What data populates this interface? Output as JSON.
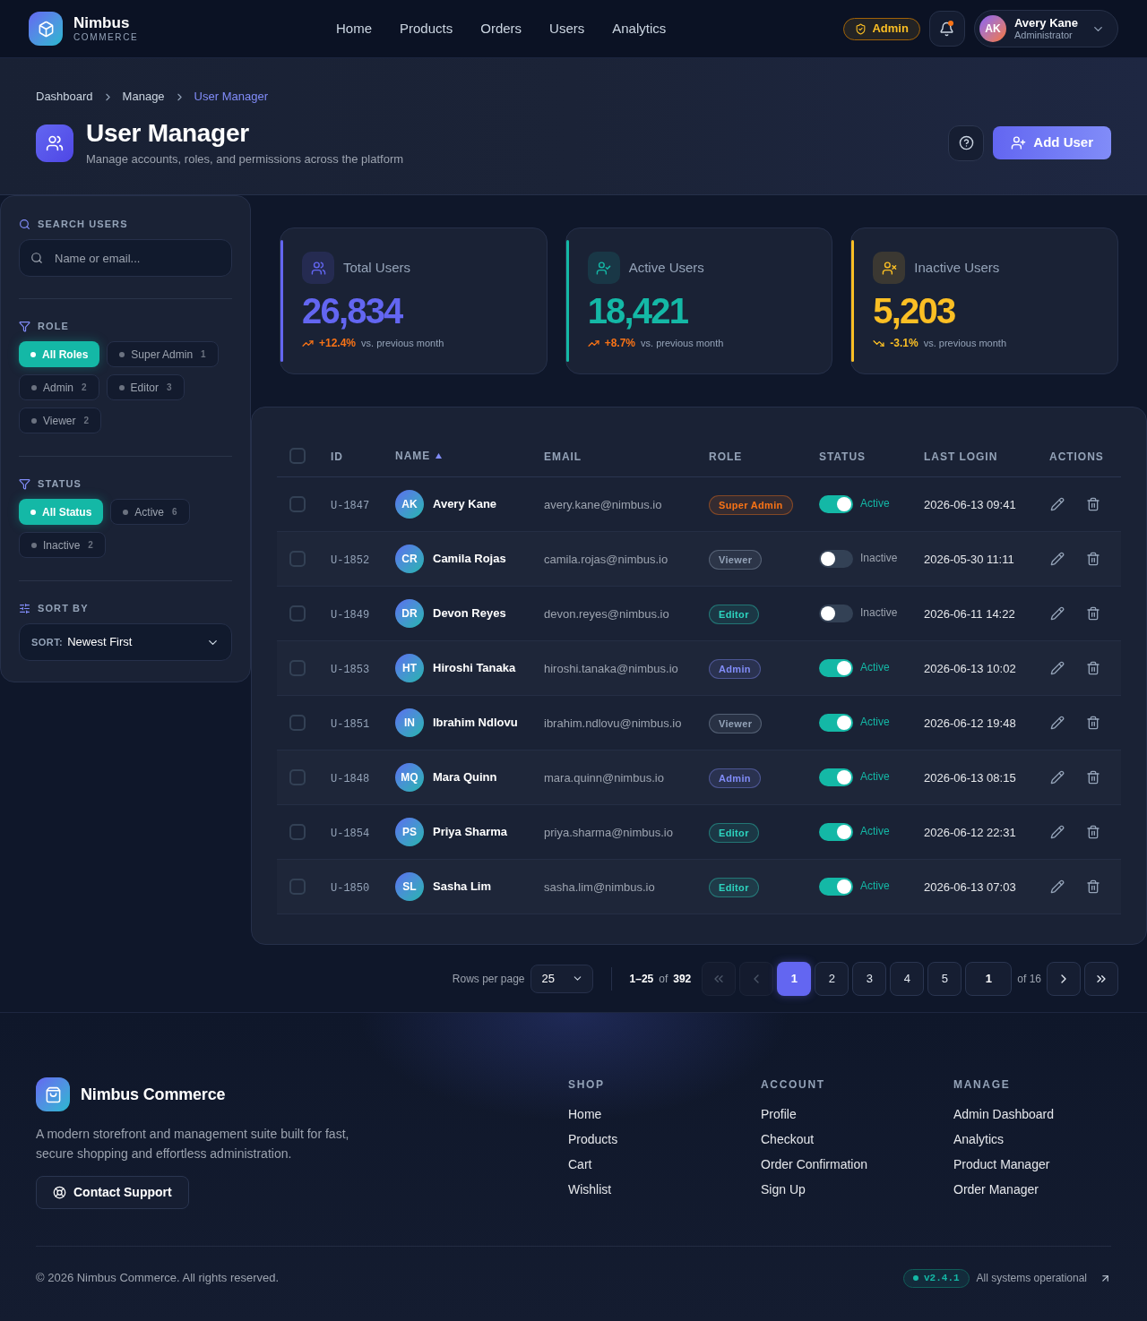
{
  "header": {
    "brand": {
      "name": "Nimbus",
      "tagline": "COMMERCE"
    },
    "nav": [
      {
        "label": "Home",
        "selected": false
      },
      {
        "label": "Products",
        "selected": false
      },
      {
        "label": "Orders",
        "selected": false
      },
      {
        "label": "Users",
        "selected": false
      },
      {
        "label": "Analytics",
        "selected": false
      }
    ],
    "role_badge": "Admin",
    "notifications": {
      "unread": true
    },
    "user": {
      "initials": "AK",
      "name": "Avery Kane",
      "role": "Administrator"
    }
  },
  "page": {
    "breadcrumb": [
      {
        "label": "Dashboard",
        "current": false
      },
      {
        "label": "Manage",
        "current": false
      },
      {
        "label": "User Manager",
        "current": true
      }
    ],
    "title": "User Manager",
    "subtitle": "Manage accounts, roles, and permissions across the platform",
    "primary_action": "Add User"
  },
  "filters": {
    "search": {
      "label": "SEARCH USERS",
      "placeholder": "Name or email..."
    },
    "role": {
      "label": "ROLE",
      "options": [
        {
          "label": "All Roles",
          "selected": true
        },
        {
          "label": "Super Admin",
          "count": "1",
          "selected": false
        },
        {
          "label": "Admin",
          "count": "2",
          "selected": false
        },
        {
          "label": "Editor",
          "count": "3",
          "selected": false
        },
        {
          "label": "Viewer",
          "count": "2",
          "selected": false
        }
      ]
    },
    "status": {
      "label": "STATUS",
      "options": [
        {
          "label": "All Status",
          "selected": true
        },
        {
          "label": "Active",
          "count": "6",
          "selected": false
        },
        {
          "label": "Inactive",
          "count": "2",
          "selected": false
        }
      ]
    },
    "sort": {
      "label": "SORT BY",
      "prefix": "SORT:",
      "value": "Newest First"
    }
  },
  "stats": [
    {
      "kind": "total",
      "label": "Total Users",
      "value": "26,834",
      "change": "+12.4%",
      "rising": true,
      "note": "vs. previous month",
      "color": "#6366f1"
    },
    {
      "kind": "active",
      "label": "Active Users",
      "value": "18,421",
      "change": "+8.7%",
      "rising": true,
      "note": "vs. previous month",
      "color": "#14b8a6"
    },
    {
      "kind": "inactive",
      "label": "Inactive Users",
      "value": "5,203",
      "change": "-3.1%",
      "rising": false,
      "note": "vs. previous month",
      "color": "#fbbf24"
    }
  ],
  "table": {
    "select_all": {
      "checked": false
    },
    "columns": [
      {
        "label": "ID",
        "sorted": false
      },
      {
        "label": "NAME",
        "sorted": true
      },
      {
        "label": "EMAIL",
        "sorted": false
      },
      {
        "label": "ROLE",
        "sorted": false
      },
      {
        "label": "STATUS",
        "sorted": false
      },
      {
        "label": "LAST LOGIN",
        "sorted": false
      },
      {
        "label": "ACTIONS",
        "sorted": false
      }
    ],
    "rows": [
      {
        "selected": false,
        "id": "U-1847",
        "initials": "AK",
        "name": "Avery Kane",
        "email": "avery.kane@nimbus.io",
        "role": {
          "label": "Super Admin",
          "color": "#f97316"
        },
        "active": true,
        "status": "Active",
        "last_login": "2026-06-13 09:41"
      },
      {
        "selected": false,
        "id": "U-1852",
        "initials": "CR",
        "name": "Camila Rojas",
        "email": "camila.rojas@nimbus.io",
        "role": {
          "label": "Viewer",
          "color": "#94a3b8"
        },
        "active": false,
        "status": "Inactive",
        "last_login": "2026-05-30 11:11"
      },
      {
        "selected": false,
        "id": "U-1849",
        "initials": "DR",
        "name": "Devon Reyes",
        "email": "devon.reyes@nimbus.io",
        "role": {
          "label": "Editor",
          "color": "#2dd4bf"
        },
        "active": false,
        "status": "Inactive",
        "last_login": "2026-06-11 14:22"
      },
      {
        "selected": false,
        "id": "U-1853",
        "initials": "HT",
        "name": "Hiroshi Tanaka",
        "email": "hiroshi.tanaka@nimbus.io",
        "role": {
          "label": "Admin",
          "color": "#818cf8"
        },
        "active": true,
        "status": "Active",
        "last_login": "2026-06-13 10:02"
      },
      {
        "selected": false,
        "id": "U-1851",
        "initials": "IN",
        "name": "Ibrahim Ndlovu",
        "email": "ibrahim.ndlovu@nimbus.io",
        "role": {
          "label": "Viewer",
          "color": "#94a3b8"
        },
        "active": true,
        "status": "Active",
        "last_login": "2026-06-12 19:48"
      },
      {
        "selected": false,
        "id": "U-1848",
        "initials": "MQ",
        "name": "Mara Quinn",
        "email": "mara.quinn@nimbus.io",
        "role": {
          "label": "Admin",
          "color": "#818cf8"
        },
        "active": true,
        "status": "Active",
        "last_login": "2026-06-13 08:15"
      },
      {
        "selected": false,
        "id": "U-1854",
        "initials": "PS",
        "name": "Priya Sharma",
        "email": "priya.sharma@nimbus.io",
        "role": {
          "label": "Editor",
          "color": "#2dd4bf"
        },
        "active": true,
        "status": "Active",
        "last_login": "2026-06-12 22:31"
      },
      {
        "selected": false,
        "id": "U-1850",
        "initials": "SL",
        "name": "Sasha Lim",
        "email": "sasha.lim@nimbus.io",
        "role": {
          "label": "Editor",
          "color": "#2dd4bf"
        },
        "active": true,
        "status": "Active",
        "last_login": "2026-06-13 07:03"
      }
    ]
  },
  "pagination": {
    "rows_per_page_label": "Rows per page",
    "rows_per_page": "25",
    "range": "1–25",
    "of_label": "of",
    "total": "392",
    "nav_buttons": [
      {
        "kind": "first",
        "disabled": true
      },
      {
        "kind": "prev",
        "disabled": true
      },
      {
        "kind": "next",
        "disabled": false
      },
      {
        "kind": "last",
        "disabled": false
      }
    ],
    "pages": [
      {
        "label": "1",
        "selected": true
      },
      {
        "label": "2",
        "selected": false
      },
      {
        "label": "3",
        "selected": false
      },
      {
        "label": "4",
        "selected": false
      },
      {
        "label": "5",
        "selected": false
      }
    ],
    "page_input": "1",
    "page_count": "of 16"
  },
  "footer": {
    "brand": "Nimbus Commerce",
    "description": "A modern storefront and management suite built for fast, secure shopping and effortless administration.",
    "contact": "Contact Support",
    "columns": [
      {
        "title": "SHOP",
        "links": [
          "Home",
          "Products",
          "Cart",
          "Wishlist"
        ]
      },
      {
        "title": "ACCOUNT",
        "links": [
          "Profile",
          "Checkout",
          "Order Confirmation",
          "Sign Up"
        ]
      },
      {
        "title": "MANAGE",
        "links": [
          "Admin Dashboard",
          "Analytics",
          "Product Manager",
          "Order Manager"
        ]
      }
    ],
    "copyright": "© 2026 Nimbus Commerce. All rights reserved.",
    "version": "v2.4.1",
    "status": "All systems operational"
  }
}
